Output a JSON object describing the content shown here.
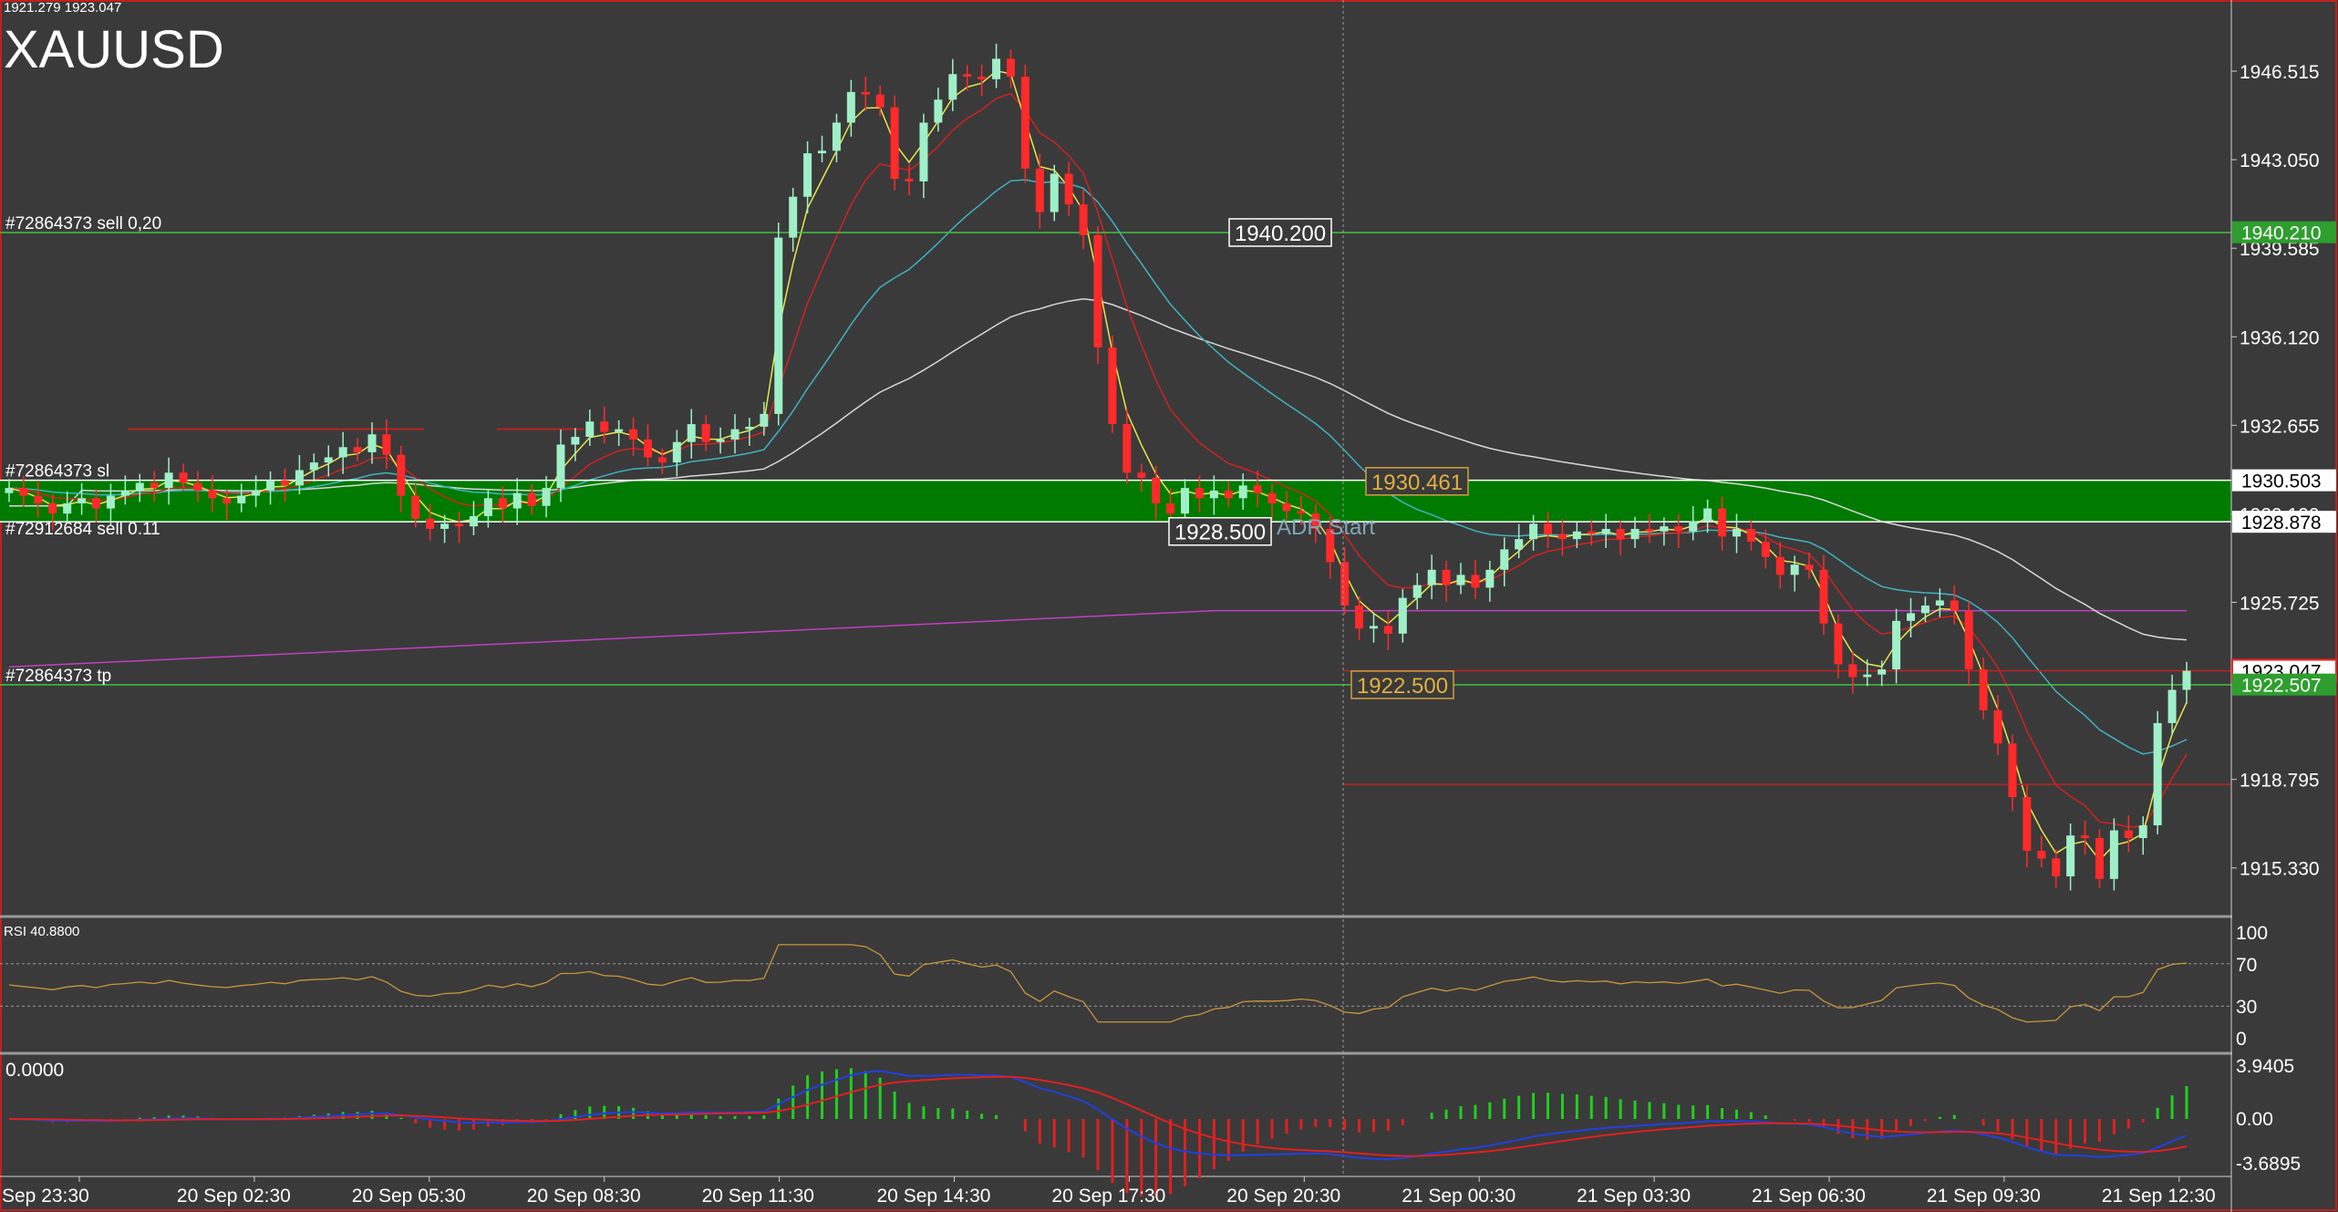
{
  "header": {
    "price_readout": "1921.279 1923.047",
    "symbol": "XAUUSD"
  },
  "price_axis": {
    "ticks": [
      {
        "label": "1946.515",
        "value": 1946.515
      },
      {
        "label": "1943.050",
        "value": 1943.05
      },
      {
        "label": "1939.585",
        "value": 1939.585
      },
      {
        "label": "1936.120",
        "value": 1936.12
      },
      {
        "label": "1932.655",
        "value": 1932.655
      },
      {
        "label": "1929.190",
        "value": 1929.19
      },
      {
        "label": "1925.725",
        "value": 1925.725
      },
      {
        "label": "1918.795",
        "value": 1918.795
      },
      {
        "label": "1915.330",
        "value": 1915.33
      }
    ],
    "tags": [
      {
        "label": "1940.210",
        "value": 1940.21,
        "bg": "#2e9e2e",
        "fg": "#ffffff"
      },
      {
        "label": "1930.503",
        "value": 1930.503,
        "bg": "#ffffff",
        "fg": "#000000"
      },
      {
        "label": "1928.878",
        "value": 1928.878,
        "bg": "#ffffff",
        "fg": "#000000"
      },
      {
        "label": "1923.047",
        "value": 1923.047,
        "bg": "#ffffff",
        "fg": "#000000",
        "border": "#ff2020"
      },
      {
        "label": "1922.507",
        "value": 1922.507,
        "bg": "#2e9e2e",
        "fg": "#ffffff"
      }
    ]
  },
  "trade_lines": [
    {
      "label": "#72864373 sell 0,20",
      "value": 1940.2,
      "color": "#3fc23f"
    },
    {
      "label": "#72864373 sl",
      "value": 1930.503,
      "color": "#ffffff"
    },
    {
      "label": "#72912684 sell 0.11",
      "value": 1928.878,
      "color": "#ffffff"
    },
    {
      "label": "#72864373 tp",
      "value": 1922.5,
      "color": "#3fc23f"
    }
  ],
  "zone": {
    "top": 1930.503,
    "bottom": 1928.878,
    "color": "#007a00"
  },
  "boxed_labels": [
    {
      "text": "1940.200",
      "value": 1940.2,
      "style": "white"
    },
    {
      "text": "1930.461",
      "value": 1930.461,
      "style": "orange"
    },
    {
      "text": "1928.500",
      "value": 1928.5,
      "style": "white"
    },
    {
      "text": "1922.500",
      "value": 1922.5,
      "style": "orange"
    }
  ],
  "adr_label": "ADR Start",
  "rsi": {
    "title": "RSI 40.8800",
    "levels": [
      "100",
      "70",
      "30",
      "0"
    ]
  },
  "macd": {
    "title": "0.0000",
    "levels": [
      "3.9405",
      "0.00",
      "-3.6895"
    ]
  },
  "time_axis": [
    "Sep 23:30",
    "20 Sep 02:30",
    "20 Sep 05:30",
    "20 Sep 08:30",
    "20 Sep 11:30",
    "20 Sep 14:30",
    "20 Sep 17:30",
    "20 Sep 20:30",
    "21 Sep 00:30",
    "21 Sep 03:30",
    "21 Sep 06:30",
    "21 Sep 09:30",
    "21 Sep 12:30"
  ],
  "colors": {
    "background": "#3a3a3a",
    "bull_candle": "#9ff0c8",
    "bear_candle": "#ff2a2a",
    "ma_fast": "#e6e64a",
    "ma_red": "#d42020",
    "ma_cyan": "#3fb3c0",
    "ma_white": "#d8d8d8",
    "ma_magenta": "#c040c0",
    "rsi_line": "#c8963c"
  },
  "chart_data": {
    "type": "candlestick",
    "symbol": "XAUUSD",
    "timeframe_step_hours": 0.5,
    "ohlc_close": [
      1930.2,
      1929.9,
      1929.6,
      1929.2,
      1929.6,
      1929.8,
      1929.4,
      1929.9,
      1930.1,
      1930.4,
      1930.2,
      1930.8,
      1930.4,
      1930.1,
      1929.8,
      1929.6,
      1929.9,
      1930.1,
      1930.5,
      1930.3,
      1930.9,
      1931.2,
      1931.4,
      1931.8,
      1931.6,
      1932.3,
      1931.5,
      1929.9,
      1929.0,
      1928.6,
      1928.8,
      1928.7,
      1929.1,
      1929.8,
      1929.4,
      1930.0,
      1929.5,
      1930.2,
      1931.9,
      1932.2,
      1932.8,
      1932.4,
      1932.5,
      1932.1,
      1931.4,
      1931.2,
      1932.0,
      1932.7,
      1932.0,
      1932.1,
      1932.5,
      1932.6,
      1933.1,
      1940.0,
      1941.6,
      1943.3,
      1943.4,
      1944.5,
      1945.7,
      1945.6,
      1945.1,
      1942.3,
      1942.2,
      1944.5,
      1945.4,
      1946.4,
      1946.3,
      1946.2,
      1947.0,
      1946.3,
      1942.7,
      1941.0,
      1942.5,
      1941.3,
      1940.1,
      1935.7,
      1932.7,
      1930.8,
      1930.6,
      1929.6,
      1929.2,
      1930.2,
      1929.8,
      1930.1,
      1929.8,
      1930.3,
      1930.0,
      1929.6,
      1929.3,
      1929.2,
      1928.6,
      1927.3,
      1925.6,
      1924.7,
      1924.8,
      1924.5,
      1925.9,
      1926.4,
      1927.0,
      1926.4,
      1926.8,
      1926.3,
      1927.0,
      1927.8,
      1928.2,
      1928.8,
      1928.4,
      1928.2,
      1928.5,
      1928.4,
      1928.6,
      1928.2,
      1928.6,
      1928.5,
      1928.7,
      1928.5,
      1928.9,
      1929.4,
      1928.3,
      1928.6,
      1928.1,
      1927.5,
      1926.8,
      1927.2,
      1927.0,
      1924.9,
      1923.3,
      1922.8,
      1922.9,
      1923.1,
      1925.0,
      1925.3,
      1925.6,
      1925.8,
      1925.4,
      1923.1,
      1921.5,
      1920.2,
      1918.1,
      1916.0,
      1915.7,
      1915.0,
      1916.6,
      1916.5,
      1914.9,
      1916.8,
      1916.5,
      1917.0,
      1921.0,
      1922.3,
      1923.047
    ],
    "series": [
      {
        "name": "RSI",
        "last": 40.88
      }
    ],
    "y_range": [
      1913.5,
      1949.3
    ],
    "x_range_labels": [
      "Sep 23:30",
      "21 Sep 12:30"
    ]
  }
}
